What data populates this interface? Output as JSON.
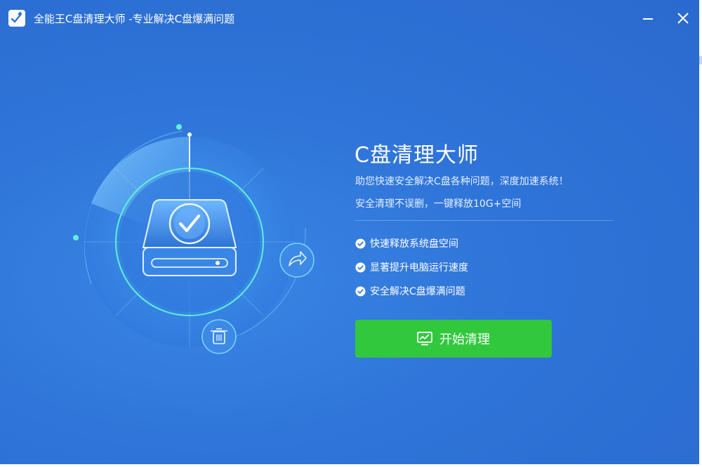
{
  "window": {
    "title": "全能王C盘清理大师  -专业解决C盘爆满问题",
    "minimize_icon": "minimize-icon",
    "close_icon": "close-icon"
  },
  "main": {
    "heading": "C盘清理大师",
    "description_line1": "助您快速安全解决C盘各种问题，深度加速系统！",
    "description_line2": "安全清理不误删，一键释放10G+空间",
    "features": [
      {
        "label": "快速释放系统盘空间",
        "icon": "check-circle-icon"
      },
      {
        "label": "显著提升电脑运行速度",
        "icon": "check-circle-icon"
      },
      {
        "label": "安全解决C盘爆满问题",
        "icon": "check-circle-icon"
      }
    ],
    "start_button_label": "开始清理",
    "start_button_icon": "monitor-chart-icon"
  },
  "colors": {
    "background": "#2f74d8",
    "button_green": "#32c83e",
    "accent_cyan": "#5ff0d8"
  }
}
